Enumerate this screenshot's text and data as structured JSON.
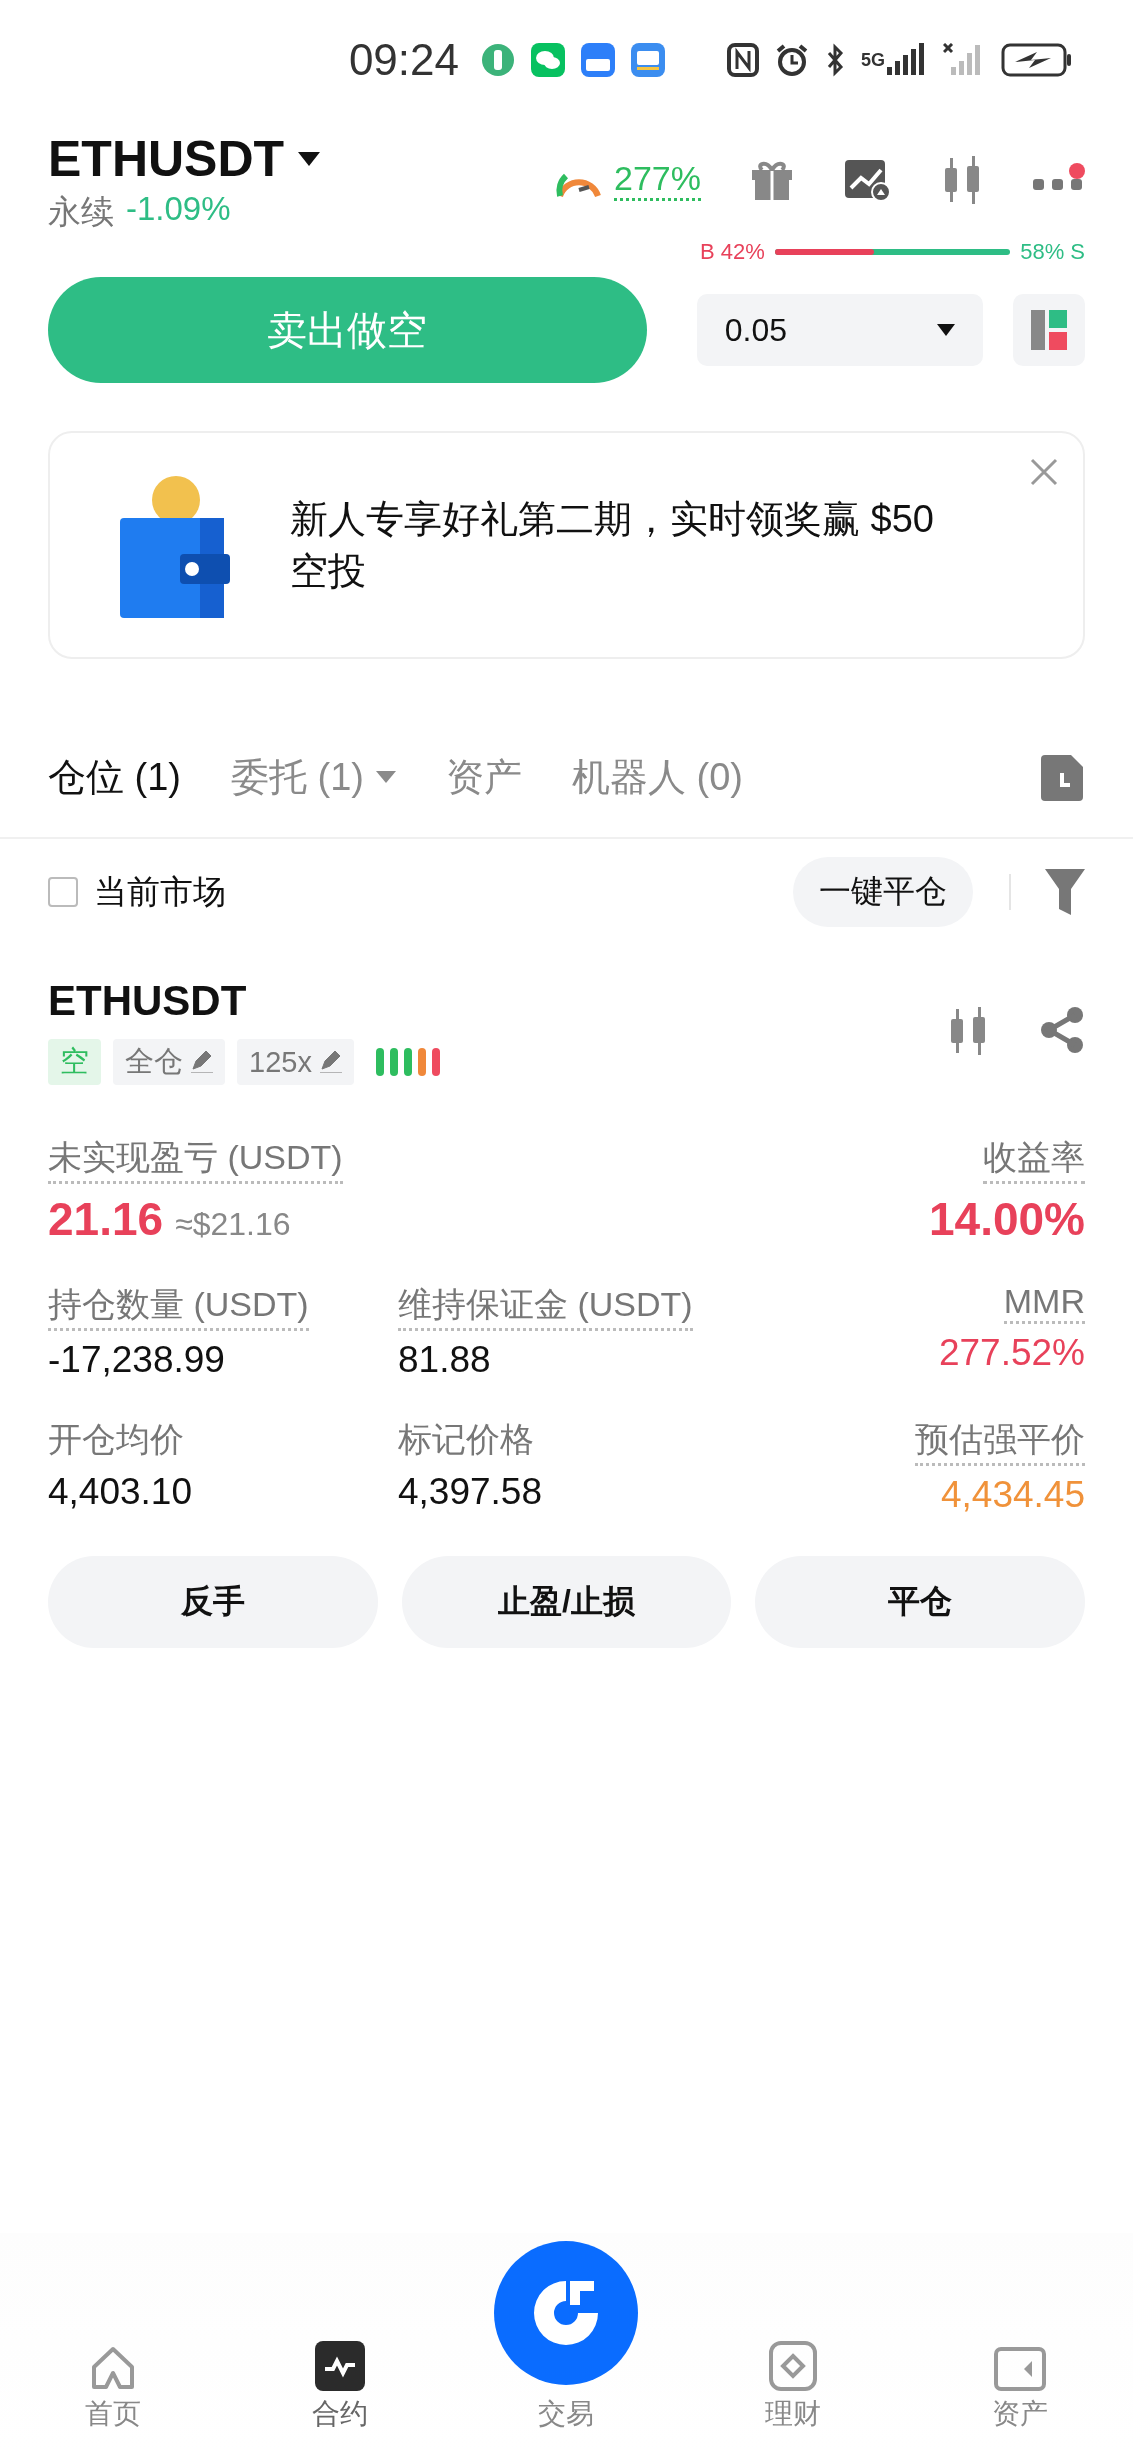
{
  "status_bar": {
    "time": "09:24",
    "network": "5G"
  },
  "header": {
    "symbol": "ETHUSDT",
    "market": "永续",
    "change": "-1.09%",
    "risk_ratio": "277%",
    "notification": true
  },
  "ratio": {
    "buy": "B 42%",
    "sell": "58% S",
    "level": 0.42
  },
  "order": {
    "sell_button": "卖出做空",
    "quantity": "0.05"
  },
  "banner": {
    "text": "新人专享好礼第二期，实时领奖赢 $50 空投"
  },
  "tabs": [
    {
      "label": "仓位 (1)",
      "selected": true,
      "has_menu": false
    },
    {
      "label": "委托 (1)",
      "selected": false,
      "has_menu": true
    },
    {
      "label": "资产",
      "selected": false,
      "has_menu": false
    },
    {
      "label": "机器人 (0)",
      "selected": false,
      "has_menu": false
    }
  ],
  "filter": {
    "label": "当前市场",
    "checked": false,
    "close_all_button": "一键平仓"
  },
  "position": {
    "symbol": "ETHUSDT",
    "side": "空",
    "margin_mode": "全仓",
    "leverage": "125x",
    "risk_bars": [
      {
        "color": "#2ebd5f"
      },
      {
        "color": "#2ebd5f"
      },
      {
        "color": "#2ebd5f"
      },
      {
        "color": "#f0883a"
      },
      {
        "color": "#ef4b5f"
      }
    ],
    "metrics": [
      {
        "label": "未实现盈亏 (USDT)",
        "value": "21.16",
        "secondary": "≈$21.16",
        "color": "#e8415a",
        "large": true,
        "dotted": true
      },
      {
        "label": "收益率",
        "value": "14.00%",
        "color": "#e8415a",
        "large": true,
        "dotted": true
      },
      {
        "label": "持仓数量 (USDT)",
        "value": "-17,238.99",
        "color": "#111111",
        "large": false,
        "dotted": true
      },
      {
        "label": "维持保证金 (USDT)",
        "value": "81.88",
        "color": "#111111",
        "large": false,
        "dotted": true
      },
      {
        "label": "MMR",
        "value": "277.52%",
        "color": "#e8415a",
        "large": false,
        "dotted": true
      },
      {
        "label": "开仓均价",
        "value": "4,403.10",
        "color": "#111111",
        "large": false,
        "dotted": false
      },
      {
        "label": "标记价格",
        "value": "4,397.58",
        "color": "#111111",
        "large": false,
        "dotted": false
      },
      {
        "label": "预估强平价",
        "value": "4,434.45",
        "color": "#f0923a",
        "large": false,
        "dotted": true
      }
    ],
    "actions": [
      "反手",
      "止盈/止损",
      "平仓"
    ]
  },
  "nav": [
    {
      "label": "首页",
      "kind": "home",
      "selected": false
    },
    {
      "label": "合约",
      "kind": "futures",
      "selected": true
    },
    {
      "label": "交易",
      "kind": "center",
      "selected": false
    },
    {
      "label": "理财",
      "kind": "earn",
      "selected": false
    },
    {
      "label": "资产",
      "kind": "assets",
      "selected": false
    }
  ]
}
